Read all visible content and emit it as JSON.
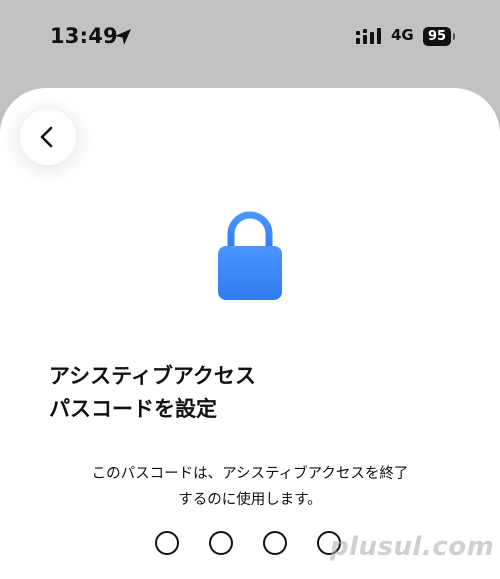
{
  "status_bar": {
    "time": "13:49",
    "network": "4G",
    "battery": "95",
    "location_icon": "location-arrow-icon",
    "signal_icon": "signal-bars-icon"
  },
  "navigation": {
    "back_icon": "chevron-left-icon"
  },
  "main": {
    "lock_icon": "lock-icon",
    "lock_color": "#3d8af7",
    "title": "アシスティブアクセス\nパスコードを設定",
    "description": "このパスコードは、アシスティブアクセスを終了\nするのに使用します。",
    "passcode_length": 4
  },
  "watermark": "plusul.com"
}
